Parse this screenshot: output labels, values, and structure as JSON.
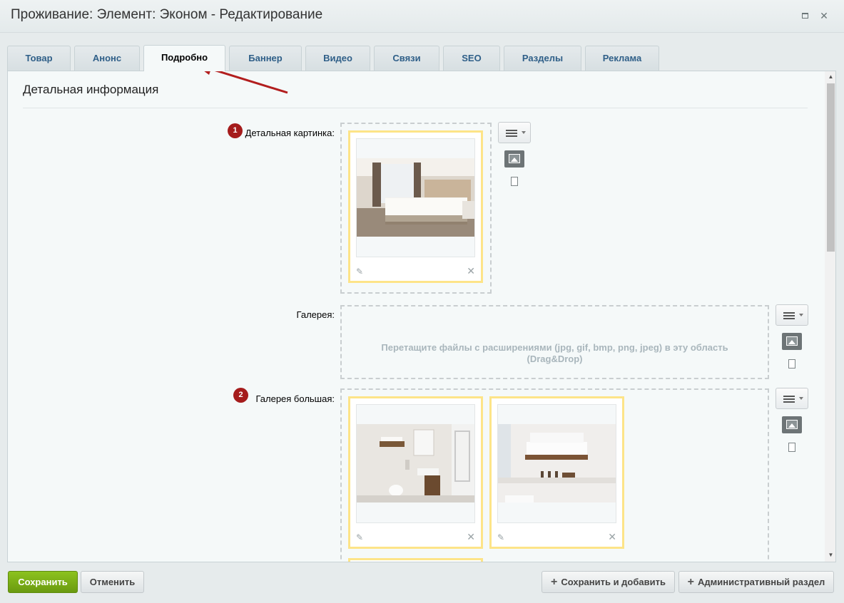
{
  "window": {
    "title": "Проживание: Элемент: Эконом - Редактирование"
  },
  "tabs": [
    {
      "label": "Товар"
    },
    {
      "label": "Анонс"
    },
    {
      "label": "Подробно"
    },
    {
      "label": "Баннер"
    },
    {
      "label": "Видео"
    },
    {
      "label": "Связи"
    },
    {
      "label": "SEO"
    },
    {
      "label": "Разделы"
    },
    {
      "label": "Реклама"
    }
  ],
  "active_tab": "Подробно",
  "section": {
    "title": "Детальная информация"
  },
  "fields": {
    "detail_picture": {
      "label": "Детальная картинка:",
      "badge": "1"
    },
    "gallery": {
      "label": "Галерея:",
      "hint_line1": "Перетащите файлы с расширениями (jpg, gif, bmp, png, jpeg) в эту область",
      "hint_line2": "(Drag&Drop)"
    },
    "gallery_big": {
      "label": "Галерея большая:",
      "badge": "2"
    }
  },
  "buttons": {
    "save": "Сохранить",
    "cancel": "Отменить",
    "save_add": "Сохранить и добавить",
    "admin_section": "Административный раздел"
  },
  "colors": {
    "accent_green": "#7ab317",
    "tab_text": "#2f5f88",
    "badge": "#a51c1c",
    "card_border": "#fde488",
    "arrow": "#b21e1e"
  }
}
